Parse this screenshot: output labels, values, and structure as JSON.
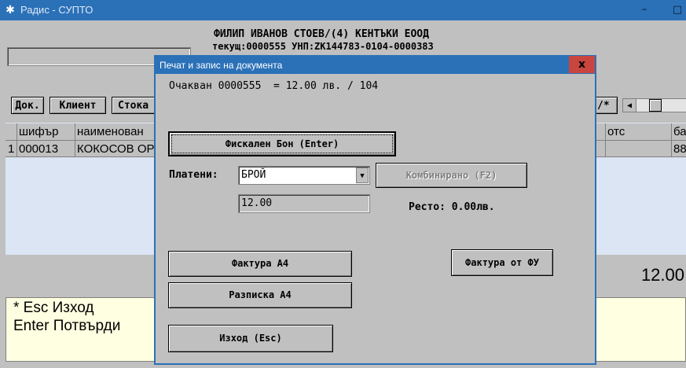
{
  "window": {
    "title": "Радис - СУПТО",
    "minimize": "–",
    "maximize": "□"
  },
  "header": {
    "company": "ФИЛИП ИВАНОВ СТОЕВ/(4) КЕНТЪКИ ЕООД",
    "receipt_info": "текущ:0000555 УНП:ZK144783-0104-0000383"
  },
  "toolbar": {
    "doc_label": "Док.",
    "client_label": "Клиент",
    "stock_label": "Стока",
    "slash_label": "/*"
  },
  "grid": {
    "row_number": "1",
    "headers": {
      "code": "шифър",
      "name": "наименован",
      "discount": "отс",
      "last": "ба"
    },
    "row": {
      "code": "000013",
      "name": "КОКОСОВ ОР",
      "discount": "",
      "last": "88"
    }
  },
  "total": "12.00",
  "hints": {
    "esc": "* Esc Изход",
    "enter": "Enter Потвърди"
  },
  "dialog": {
    "title": "Печат и запис на документа",
    "close": "x",
    "expected": "Очакван 0000555  = 12.00 лв. / 104",
    "fiscal_button": "Фискален Бон (Enter)",
    "paid_label": "Платени:",
    "payment_method": "БРОЙ",
    "combined_button": "Комбинирано (F2)",
    "amount": "12.00",
    "change": "Ресто: 0.00лв.",
    "invoice_button": "Фактура A4",
    "invoice_fu_button": "Фактура от ФУ",
    "receipt_button": "Разписка A4",
    "exit_button": "Изход (Esc)"
  }
}
